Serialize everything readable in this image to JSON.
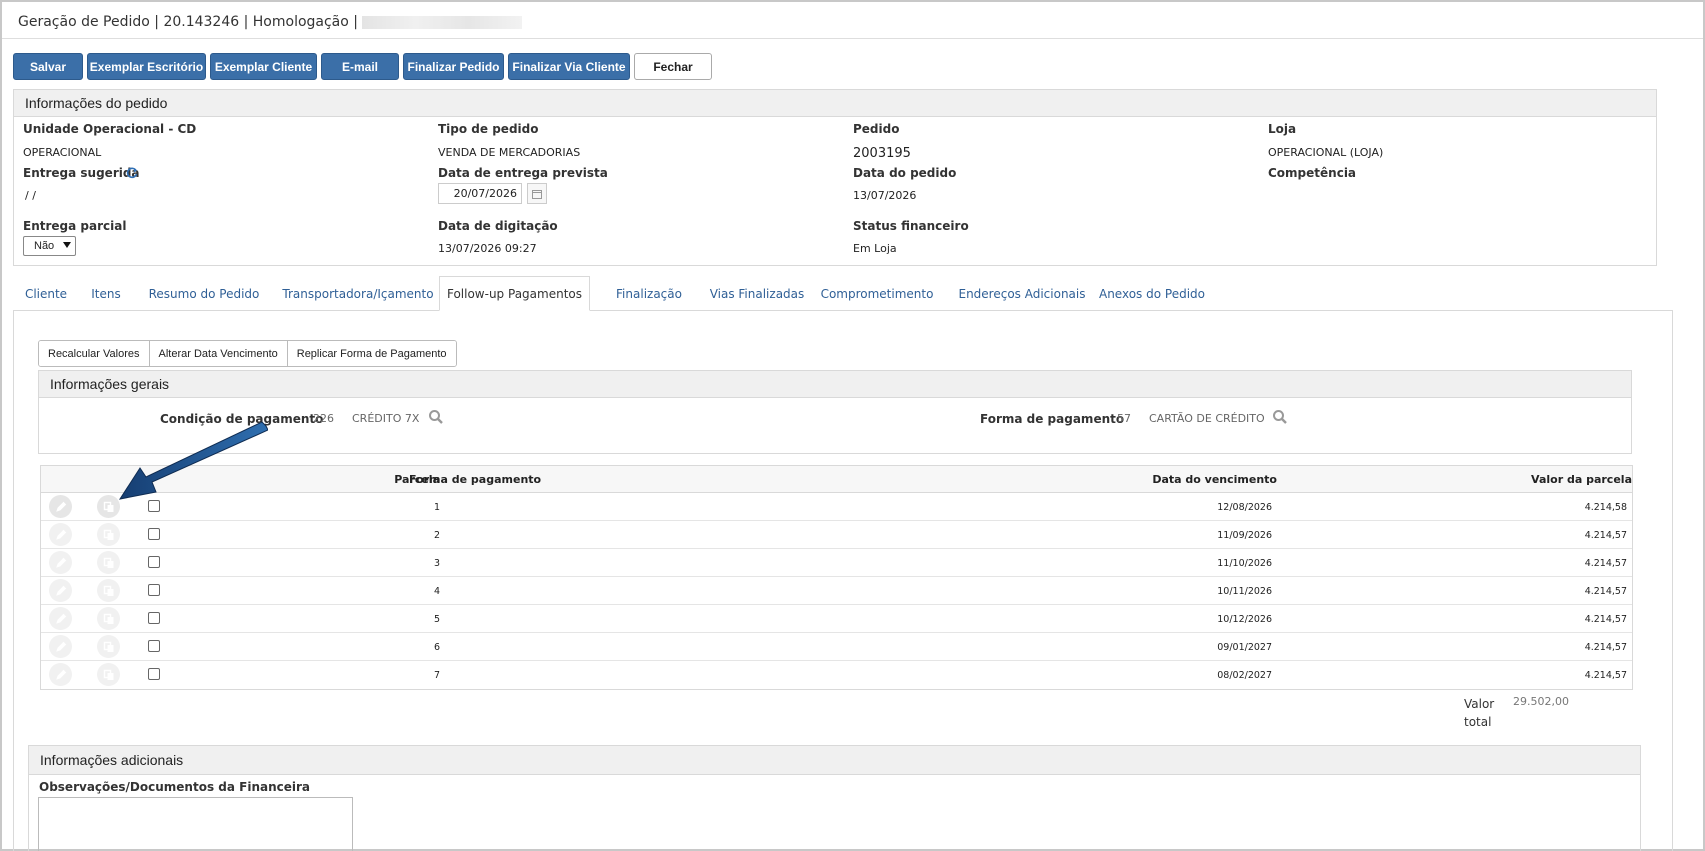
{
  "window": {
    "title": "Geração de Pedido | 20.143246 | Homologação |"
  },
  "toolbar": {
    "buttons": [
      {
        "label": "Salvar",
        "style": "blue"
      },
      {
        "label": "Exemplar Escritório",
        "style": "blue"
      },
      {
        "label": "Exemplar Cliente",
        "style": "blue"
      },
      {
        "label": "E-mail",
        "style": "blue"
      },
      {
        "label": "Finalizar Pedido",
        "style": "blue"
      },
      {
        "label": "Finalizar Via Cliente",
        "style": "blue"
      },
      {
        "label": "Fechar",
        "style": "white"
      }
    ]
  },
  "order_info": {
    "header": "Informações do pedido",
    "unidade_label": "Unidade Operacional - CD",
    "unidade_value": "OPERACIONAL",
    "tipo_label": "Tipo de pedido",
    "tipo_value": "VENDA DE MERCADORIAS",
    "pedido_label": "Pedido",
    "pedido_value": "2003195",
    "loja_label": "Loja",
    "loja_value": "OPERACIONAL (LOJA)",
    "entrega_sugerida_label": "Entrega sugerida",
    "entrega_sugerida_value": "/ /",
    "data_entrega_label": "Data de entrega prevista",
    "data_entrega_value": "20/07/2026",
    "data_pedido_label": "Data do pedido",
    "data_pedido_value": "13/07/2026",
    "competencia_label": "Competência",
    "entrega_parcial_label": "Entrega parcial",
    "entrega_parcial_value": "Não",
    "data_digitacao_label": "Data de digitação",
    "data_digitacao_value": "13/07/2026 09:27",
    "status_fin_label": "Status financeiro",
    "status_fin_value": "Em Loja"
  },
  "tabs": [
    {
      "label": "Cliente",
      "active": false
    },
    {
      "label": "Itens",
      "active": false
    },
    {
      "label": "Resumo do Pedido",
      "active": false
    },
    {
      "label": "Transportadora/Içamento",
      "active": false
    },
    {
      "label": "Follow-up Pagamentos",
      "active": true
    },
    {
      "label": "Finalização",
      "active": false
    },
    {
      "label": "Vias Finalizadas",
      "active": false
    },
    {
      "label": "Comprometimento",
      "active": false
    },
    {
      "label": "Endereços Adicionais",
      "active": false
    },
    {
      "label": "Anexos do Pedido",
      "active": false
    }
  ],
  "payments": {
    "sub_buttons": [
      "Recalcular Valores",
      "Alterar Data Vencimento",
      "Replicar Forma de Pagamento"
    ],
    "general_header": "Informações gerais",
    "condicao_label": "Condição de pagamento",
    "condicao_code": "226",
    "condicao_desc": "CRÉDITO 7X",
    "forma_label": "Forma de pagamento",
    "forma_code": "57",
    "forma_desc": "CARTÃO DE CRÉDITO",
    "columns": [
      "Parcela",
      "Forma de pagamento",
      "Data do vencimento",
      "Valor da parcela"
    ],
    "rows": [
      {
        "parcela": "1",
        "forma": "",
        "vencimento": "12/08/2026",
        "valor": "4.214,58"
      },
      {
        "parcela": "2",
        "forma": "",
        "vencimento": "11/09/2026",
        "valor": "4.214,57"
      },
      {
        "parcela": "3",
        "forma": "",
        "vencimento": "11/10/2026",
        "valor": "4.214,57"
      },
      {
        "parcela": "4",
        "forma": "",
        "vencimento": "10/11/2026",
        "valor": "4.214,57"
      },
      {
        "parcela": "5",
        "forma": "",
        "vencimento": "10/12/2026",
        "valor": "4.214,57"
      },
      {
        "parcela": "6",
        "forma": "",
        "vencimento": "09/01/2027",
        "valor": "4.214,57"
      },
      {
        "parcela": "7",
        "forma": "",
        "vencimento": "08/02/2027",
        "valor": "4.214,57"
      }
    ],
    "total_label_1": "Valor",
    "total_label_2": "total",
    "total_value": "29.502,00"
  },
  "additional": {
    "header": "Informações adicionais",
    "obs_label": "Observações/Documentos da Financeira"
  },
  "colors": {
    "primary_button": "#3b6fa8",
    "link": "#2f5f96",
    "arrow": "#1f4e86"
  },
  "icons": [
    "refresh-icon",
    "calendar-icon",
    "search-icon",
    "edit-icon",
    "copy-icon",
    "arrow-annotation"
  ]
}
